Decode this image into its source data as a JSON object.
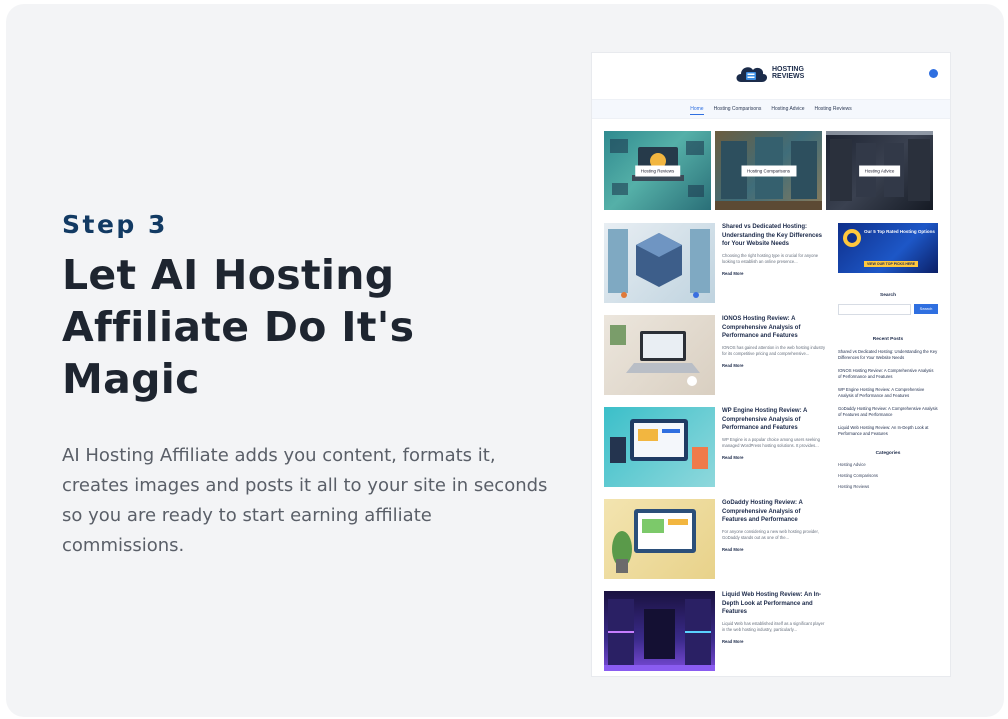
{
  "left": {
    "step": "Step 3",
    "headline": "Let AI Hosting Affiliate Do It's Magic",
    "description": "AI Hosting Affiliate adds you content, formats it, creates images and posts it all to your site in seconds so you are ready to start earning affiliate commissions."
  },
  "site": {
    "logo_line1": "HOSTING",
    "logo_line2": "REVIEWS",
    "nav": [
      "Home",
      "Hosting Comparisons",
      "Hosting Advice",
      "Hosting Reviews"
    ],
    "featured": [
      "Hosting Reviews",
      "Hosting Comparisons",
      "Hosting Advice"
    ],
    "read_more": "Read More",
    "posts": [
      {
        "title": "Shared vs Dedicated Hosting: Understanding the Key Differences for Your Website Needs",
        "excerpt": "Choosing the right hosting type is crucial for anyone looking to establish an online presence..."
      },
      {
        "title": "IONOS Hosting Review: A Comprehensive Analysis of Performance and Features",
        "excerpt": "IONOS has gained attention in the web hosting industry for its competitive pricing and comprehensive..."
      },
      {
        "title": "WP Engine Hosting Review: A Comprehensive Analysis of Performance and Features",
        "excerpt": "WP Engine is a popular choice among users seeking managed WordPress hosting solutions. It provides..."
      },
      {
        "title": "GoDaddy Hosting Review: A Comprehensive Analysis of Features and Performance",
        "excerpt": "For anyone considering a new web hosting provider, GoDaddy stands out as one of the..."
      },
      {
        "title": "Liquid Web Hosting Review: An In-Depth Look at Performance and Features",
        "excerpt": "Liquid Web has established itself as a significant player in the web hosting industry, particularly..."
      }
    ],
    "sidebar": {
      "banner_title": "Our 5 Top Rated Hosting Options",
      "banner_button": "VIEW OUR TOP PICKS HERE",
      "search_title": "Search",
      "search_button": "Search",
      "recent_title": "Recent Posts",
      "recent": [
        "Shared vs Dedicated Hosting: Understanding the Key Differences for Your Website Needs",
        "IONOS Hosting Review: A Comprehensive Analysis of Performance and Features",
        "WP Engine Hosting Review: A Comprehensive Analysis of Performance and Features",
        "GoDaddy Hosting Review: A Comprehensive Analysis of Features and Performance",
        "Liquid Web Hosting Review: An In-Depth Look at Performance and Features"
      ],
      "categories_title": "Categories",
      "categories": [
        "Hosting Advice",
        "Hosting Comparisons",
        "Hosting Reviews"
      ]
    }
  }
}
